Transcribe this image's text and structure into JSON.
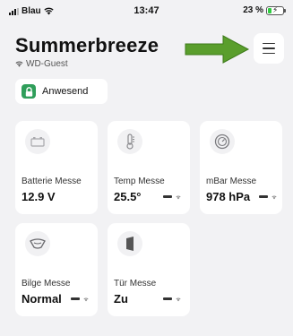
{
  "status_bar": {
    "carrier": "Blau",
    "time": "13:47",
    "battery_percent": "23 %",
    "battery_level": 0.23,
    "battery_color": "#2ecc40"
  },
  "header": {
    "title": "Summerbreeze",
    "network": "WD-Guest"
  },
  "presence": {
    "label": "Anwesend",
    "icon": "lock-icon",
    "color": "#2f9e5a"
  },
  "annotation_arrow_color": "#5a9e2c",
  "cards": [
    {
      "label": "Batterie Messe",
      "value": "12.9 V",
      "icon": "battery-icon"
    },
    {
      "label": "Temp Messe",
      "value": "25.5°",
      "icon": "thermometer-icon"
    },
    {
      "label": "mBar Messe",
      "value": "978 hPa",
      "icon": "gauge-icon"
    },
    {
      "label": "Bilge Messe",
      "value": "Normal",
      "icon": "bilge-icon"
    },
    {
      "label": "Tür Messe",
      "value": "Zu",
      "icon": "door-icon"
    }
  ]
}
